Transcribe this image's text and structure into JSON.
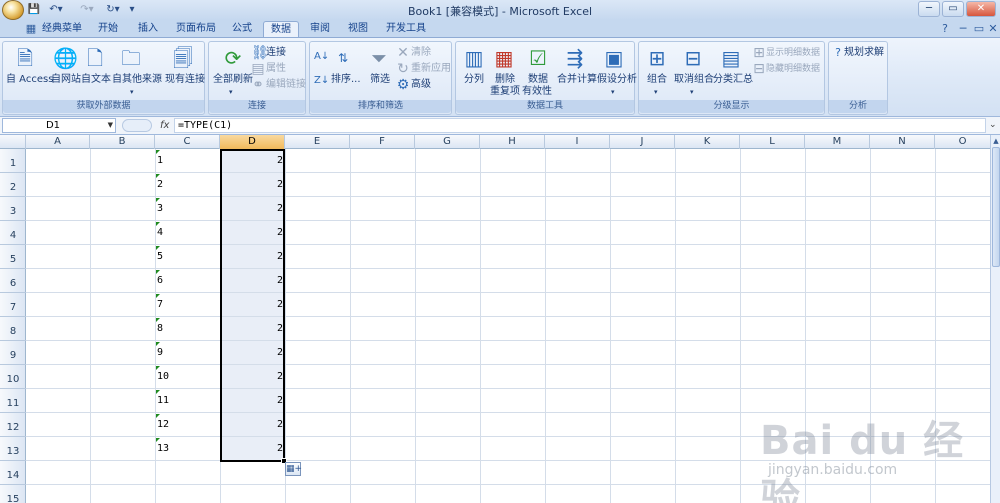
{
  "window": {
    "title": "Book1  [兼容模式] - Microsoft Excel",
    "minimize_label": "─",
    "restore_label": "▭",
    "close_label": "✕"
  },
  "quick_access": {
    "dropdown_label": "▾"
  },
  "tabs": [
    {
      "label": "经典菜单"
    },
    {
      "label": "开始"
    },
    {
      "label": "插入"
    },
    {
      "label": "页面布局"
    },
    {
      "label": "公式"
    },
    {
      "label": "数据",
      "active": true
    },
    {
      "label": "审阅"
    },
    {
      "label": "视图"
    },
    {
      "label": "开发工具"
    }
  ],
  "ribbon": {
    "groups": {
      "get_external": {
        "label": "获取外部数据",
        "buttons": [
          "自 Access",
          "自网站",
          "自文本",
          "自其他来源",
          "现有连接"
        ]
      },
      "connections": {
        "label": "连接",
        "refresh_all": "全部刷新",
        "connections": "连接",
        "properties": "属性",
        "edit_links": "编辑链接"
      },
      "sort_filter": {
        "label": "排序和筛选",
        "sort": "排序...",
        "filter": "筛选",
        "clear": "清除",
        "reapply": "重新应用",
        "advanced": "高级"
      },
      "data_tools": {
        "label": "数据工具",
        "text_to_columns": "分列",
        "remove_duplicates_1": "删除",
        "remove_duplicates_2": "重复项",
        "validation_1": "数据",
        "validation_2": "有效性",
        "consolidate": "合并计算",
        "what_if": "假设分析"
      },
      "outline": {
        "label": "分级显示",
        "group": "组合",
        "ungroup": "取消组合",
        "subtotal": "分类汇总",
        "show_detail": "显示明细数据",
        "hide_detail": "隐藏明细数据"
      },
      "analysis": {
        "label": "分析",
        "solver": "规划求解"
      }
    }
  },
  "formula_bar": {
    "name_box": "D1",
    "fx": "fx",
    "formula": "=TYPE(C1)"
  },
  "sheet": {
    "columns": [
      "A",
      "B",
      "C",
      "D",
      "E",
      "F",
      "G",
      "H",
      "I",
      "J",
      "K",
      "L",
      "M",
      "N",
      "O"
    ],
    "selected_column": "D",
    "rows": [
      "1",
      "2",
      "3",
      "4",
      "5",
      "6",
      "7",
      "8",
      "9",
      "10",
      "11",
      "12",
      "13",
      "14",
      "15"
    ],
    "column_c": [
      "1",
      "2",
      "3",
      "4",
      "5",
      "6",
      "7",
      "8",
      "9",
      "10",
      "11",
      "12",
      "13"
    ],
    "column_d": [
      "2",
      "2",
      "2",
      "2",
      "2",
      "2",
      "2",
      "2",
      "2",
      "2",
      "2",
      "2",
      "2"
    ],
    "selected_range": "D1:D13"
  },
  "watermark": {
    "main": "Bai du 经验",
    "sub": "jingyan.baidu.com"
  },
  "colors": {
    "accent": "#15428b",
    "ribbon_bg": "#dde8f7",
    "selected_header": "#f1b95b",
    "selection_fill": "#e9eef7",
    "error_triangle": "#1f8a1f"
  }
}
